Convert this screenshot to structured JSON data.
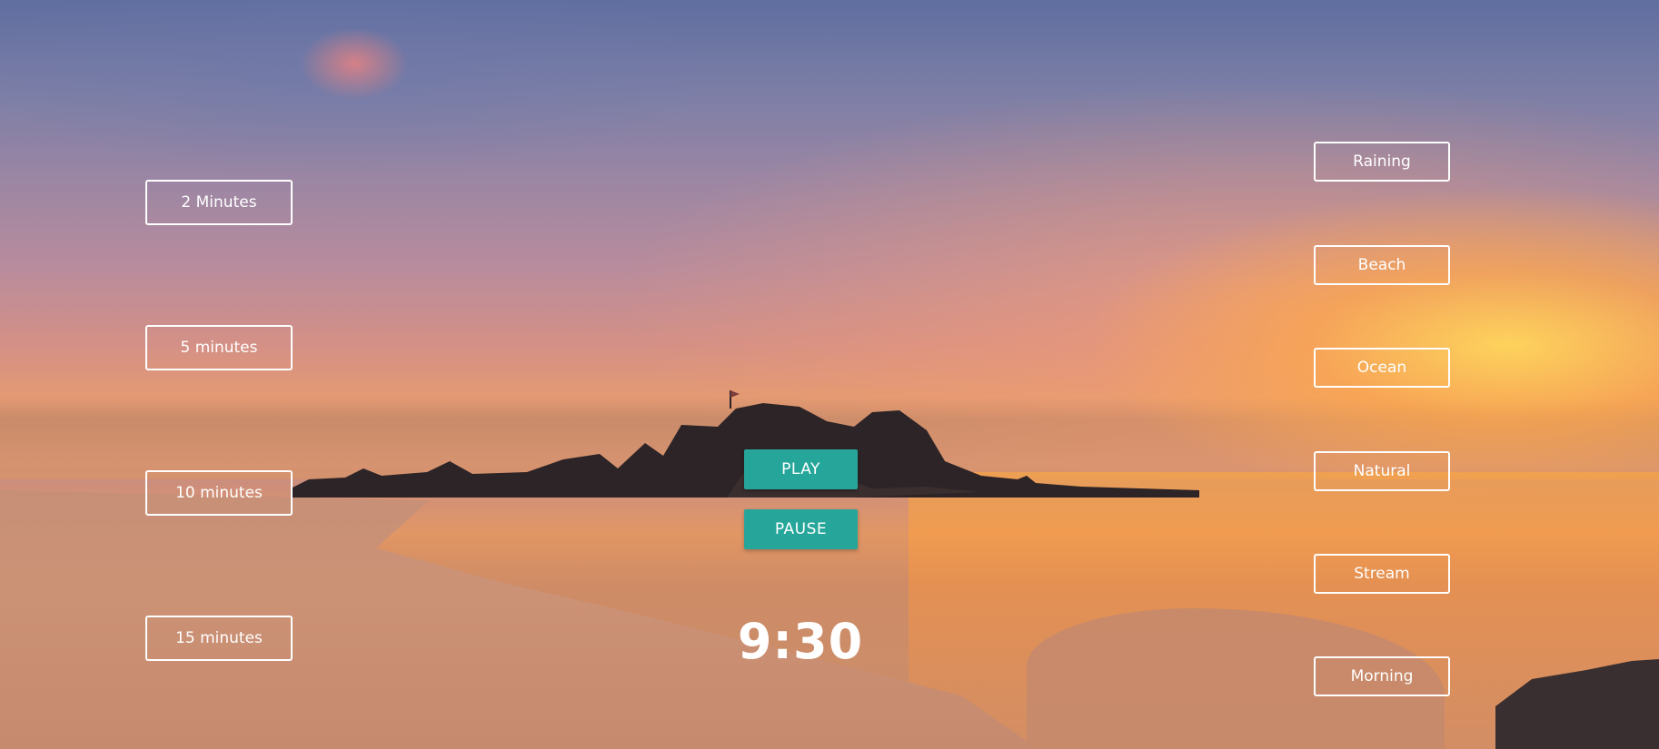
{
  "time_options": [
    {
      "label": "2 Minutes"
    },
    {
      "label": "5 minutes"
    },
    {
      "label": "10 minutes"
    },
    {
      "label": "15 minutes"
    }
  ],
  "sound_options": [
    {
      "label": "Raining"
    },
    {
      "label": "Beach"
    },
    {
      "label": "Ocean"
    },
    {
      "label": "Natural"
    },
    {
      "label": "Stream"
    },
    {
      "label": "Morning"
    }
  ],
  "controls": {
    "play_label": "PLAY",
    "pause_label": "PAUSE"
  },
  "timer": {
    "display": "9:30"
  },
  "colors": {
    "accent": "#26a69a",
    "button_outline": "#ffffff",
    "text": "#ffffff"
  }
}
